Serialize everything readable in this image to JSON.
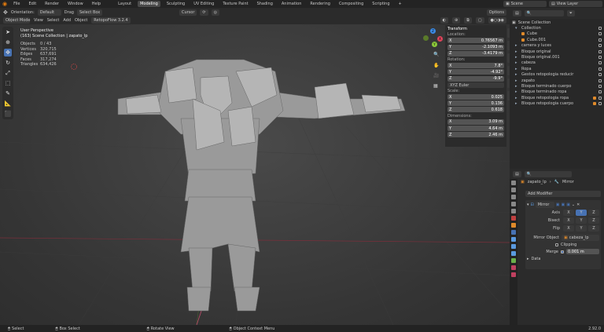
{
  "menu": {
    "items": [
      "File",
      "Edit",
      "Render",
      "Window",
      "Help"
    ],
    "workspaces": [
      "Layout",
      "Modeling",
      "Sculpting",
      "UV Editing",
      "Texture Paint",
      "Shading",
      "Animation",
      "Rendering",
      "Compositing",
      "Scripting"
    ],
    "active": "Modeling",
    "plus": "+",
    "scene": "Scene",
    "view_layer": "View Layer"
  },
  "header": {
    "orientation_label": "Orientation:",
    "orientation": "Default",
    "drag_label": "Drag",
    "select_mode": "Select Box",
    "pivot": "Cursor",
    "options": "Options",
    "mode": "Object Mode",
    "view": "View",
    "select": "Select",
    "add": "Add",
    "object": "Object",
    "addon": "RetopoFlow 3.2.4"
  },
  "viewport": {
    "title": "User Perspective",
    "subtitle": "(163) Scene Collection | zapato_lp",
    "stats": [
      {
        "k": "Objects",
        "v": "0 / 43"
      },
      {
        "k": "Vertices",
        "v": "320,715"
      },
      {
        "k": "Edges",
        "v": "637,691"
      },
      {
        "k": "Faces",
        "v": "317,274"
      },
      {
        "k": "Triangles",
        "v": "634,426"
      }
    ]
  },
  "npanel": {
    "title": "Transform",
    "location": "Location:",
    "loc": [
      {
        "a": "X",
        "v": "0.76567 m"
      },
      {
        "a": "Y",
        "v": "-2.1093 m"
      },
      {
        "a": "Z",
        "v": "-3.4179 m"
      }
    ],
    "rotation": "Rotation:",
    "rot": [
      {
        "a": "X",
        "v": "7.8°"
      },
      {
        "a": "Y",
        "v": "-4.92°"
      },
      {
        "a": "Z",
        "v": "-9.9°"
      }
    ],
    "euler": "XYZ Euler",
    "scale": "Scale:",
    "scl": [
      {
        "a": "X",
        "v": "0.025"
      },
      {
        "a": "Y",
        "v": "0.136"
      },
      {
        "a": "Z",
        "v": "0.618"
      }
    ],
    "dimensions": "Dimensions:",
    "dim": [
      {
        "a": "X",
        "v": "3.09 m"
      },
      {
        "a": "Y",
        "v": "4.64 m"
      },
      {
        "a": "Z",
        "v": "2.46 m"
      }
    ],
    "tabs": [
      "Item",
      "Tool",
      "View",
      "Edit",
      "Create",
      "Retopo"
    ]
  },
  "outliner": {
    "title": "Scene Collection",
    "rows": [
      "Collection",
      "Cube",
      "Cube.001",
      "camera y luces",
      "Bloque original",
      "Bloque original.001",
      "cabeza",
      "Ropa",
      "Gestos retopologia reducir",
      "zapato",
      "Bloque terminado cuerpo",
      "Bloque terminado ropa",
      "Bloque retopologia ropa",
      "Bloque retopologia cuerpo"
    ]
  },
  "properties": {
    "object": "zapato_lp",
    "modifier": "Mirror",
    "add_modifier": "Add Modifier",
    "mod_name": "Mirror",
    "axis": "Axis",
    "bisect": "Bisect",
    "flip": "Flip",
    "x": "X",
    "y": "Y",
    "z": "Z",
    "mirror_object_label": "Mirror Object",
    "mirror_object": "cabeza_lp",
    "clipping": "Clipping",
    "merge_label": "Merge",
    "merge_value": "0.001 m",
    "data": "Data"
  },
  "status": {
    "items": [
      "Select",
      "Box Select",
      "Rotate View",
      "Object Context Menu"
    ],
    "version": "2.92.0"
  },
  "colors": {
    "accent": "#4772b3",
    "x_axis": "#e0455b",
    "y_axis": "#8cc83a",
    "z_axis": "#3c8ce6",
    "object": "#e08a2a"
  }
}
